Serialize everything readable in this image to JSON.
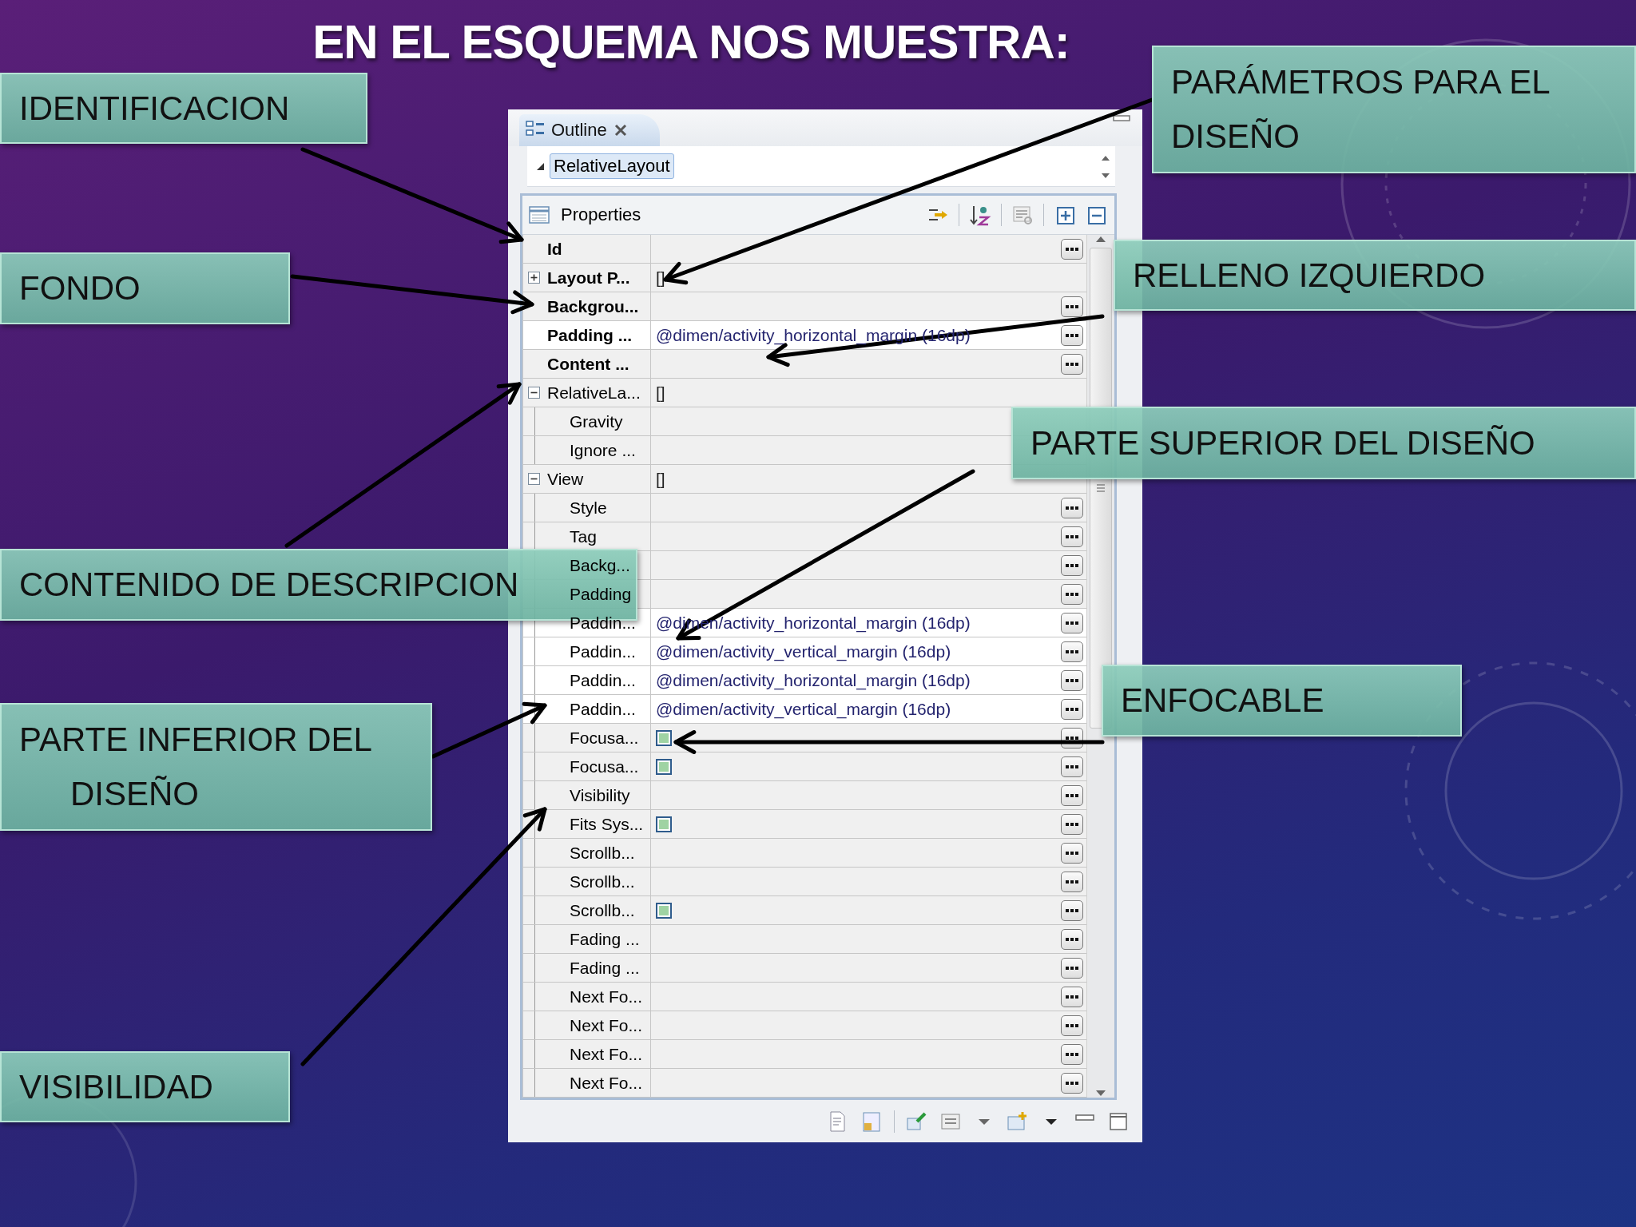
{
  "slide": {
    "title": "EN EL ESQUEMA NOS MUESTRA:"
  },
  "callouts": [
    {
      "text": "IDENTIFICACION"
    },
    {
      "text": "PARÁMETROS PARA EL DISEÑO"
    },
    {
      "text": "FONDO"
    },
    {
      "text": "RELLENO IZQUIERDO"
    },
    {
      "text": "PARTE SUPERIOR DEL DISEÑO"
    },
    {
      "text": "CONTENIDO DE DESCRIPCION"
    },
    {
      "text": "ENFOCABLE"
    },
    {
      "text": "PARTE INFERIOR DEL DISEÑO"
    },
    {
      "text": "VISIBILIDAD"
    }
  ],
  "outline_view": {
    "tab": {
      "label": "Outline",
      "selected": true
    },
    "tree": [
      {
        "label": "RelativeLayout",
        "selected": true,
        "expanded": true
      }
    ],
    "properties": {
      "title": "Properties",
      "rows": [
        {
          "name": "Id",
          "kind": "field",
          "bold": true,
          "set": false,
          "has_button": true
        },
        {
          "name": "Layout P...",
          "kind": "group",
          "value": "[]",
          "expanded": false,
          "bold": true,
          "set": false,
          "has_button": false
        },
        {
          "name": "Backgrou...",
          "kind": "field",
          "bold": true,
          "set": false,
          "has_button": true
        },
        {
          "name": "Padding ...",
          "kind": "field",
          "value": "@dimen/activity_horizontal_margin (16dp)",
          "bold": true,
          "set": true,
          "has_button": true
        },
        {
          "name": "Content ...",
          "kind": "field",
          "bold": true,
          "set": false,
          "has_button": true
        },
        {
          "name": "RelativeLa...",
          "kind": "group",
          "value": "[]",
          "expanded": true,
          "bold": false,
          "set": false,
          "has_button": false,
          "children": [
            {
              "name": "Gravity",
              "kind": "field",
              "bold": false,
              "set": false,
              "has_button": false
            },
            {
              "name": "Ignore ...",
              "kind": "field",
              "bold": false,
              "set": false,
              "has_button": false
            }
          ]
        },
        {
          "name": "View",
          "kind": "group",
          "value": "[]",
          "expanded": true,
          "bold": false,
          "set": false,
          "has_button": false,
          "children": [
            {
              "name": "Style",
              "kind": "field",
              "bold": false,
              "set": false,
              "has_button": true
            },
            {
              "name": "Tag",
              "kind": "field",
              "bold": false,
              "set": false,
              "has_button": true
            },
            {
              "name": "Backg...",
              "kind": "field",
              "bold": false,
              "set": false,
              "has_button": true
            },
            {
              "name": "Padding",
              "kind": "field",
              "bold": false,
              "set": false,
              "has_button": true
            },
            {
              "name": "Paddin...",
              "kind": "field",
              "value": "@dimen/activity_horizontal_margin (16dp)",
              "bold": false,
              "set": true,
              "has_button": true
            },
            {
              "name": "Paddin...",
              "kind": "field",
              "value": "@dimen/activity_vertical_margin (16dp)",
              "bold": false,
              "set": true,
              "has_button": true
            },
            {
              "name": "Paddin...",
              "kind": "field",
              "value": "@dimen/activity_horizontal_margin (16dp)",
              "bold": false,
              "set": true,
              "has_button": true
            },
            {
              "name": "Paddin...",
              "kind": "field",
              "value": "@dimen/activity_vertical_margin (16dp)",
              "bold": false,
              "set": true,
              "has_button": true
            },
            {
              "name": "Focusa...",
              "kind": "checkbox",
              "checked": true,
              "bold": false,
              "set": false,
              "has_button": true
            },
            {
              "name": "Focusa...",
              "kind": "checkbox",
              "checked": true,
              "bold": false,
              "set": false,
              "has_button": true
            },
            {
              "name": "Visibility",
              "kind": "field",
              "bold": false,
              "set": false,
              "has_button": true
            },
            {
              "name": "Fits Sys...",
              "kind": "checkbox",
              "checked": true,
              "bold": false,
              "set": false,
              "has_button": true
            },
            {
              "name": "Scrollb...",
              "kind": "field",
              "bold": false,
              "set": false,
              "has_button": true
            },
            {
              "name": "Scrollb...",
              "kind": "field",
              "bold": false,
              "set": false,
              "has_button": true
            },
            {
              "name": "Scrollb...",
              "kind": "checkbox",
              "checked": true,
              "bold": false,
              "set": false,
              "has_button": true
            },
            {
              "name": "Fading ...",
              "kind": "field",
              "bold": false,
              "set": false,
              "has_button": true
            },
            {
              "name": "Fading ...",
              "kind": "field",
              "bold": false,
              "set": false,
              "has_button": true
            },
            {
              "name": "Next Fo...",
              "kind": "field",
              "bold": false,
              "set": false,
              "has_button": true
            },
            {
              "name": "Next Fo...",
              "kind": "field",
              "bold": false,
              "set": false,
              "has_button": true
            },
            {
              "name": "Next Fo...",
              "kind": "field",
              "bold": false,
              "set": false,
              "has_button": true
            },
            {
              "name": "Next Fo...",
              "kind": "field",
              "bold": false,
              "set": false,
              "has_button": true
            }
          ]
        }
      ]
    }
  }
}
